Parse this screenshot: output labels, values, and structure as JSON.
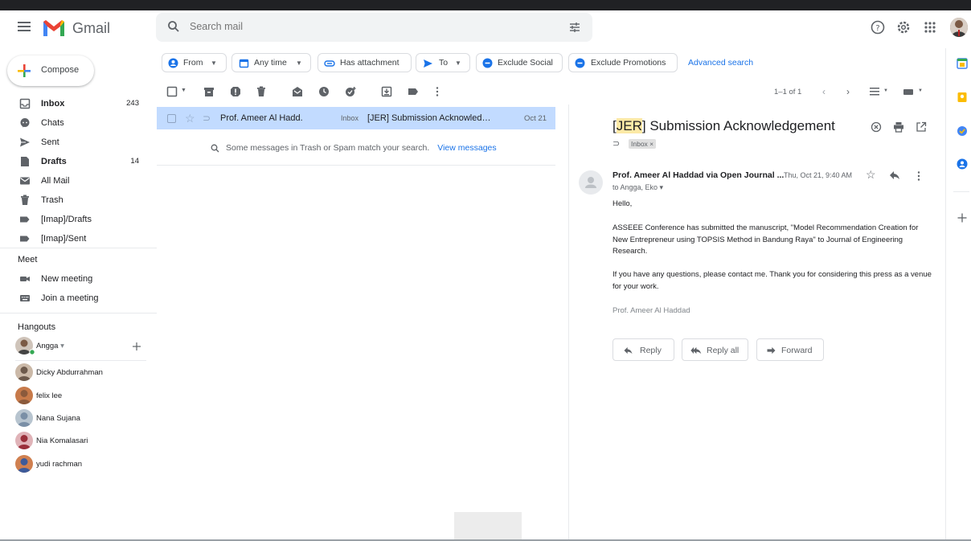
{
  "app": {
    "name": "Gmail"
  },
  "search": {
    "placeholder": "Search mail"
  },
  "compose_label": "Compose",
  "nav": [
    {
      "label": "Inbox",
      "count": "243",
      "bold": true,
      "icon": "inbox-icon"
    },
    {
      "label": "Chats",
      "count": "",
      "bold": false,
      "icon": "chat-icon"
    },
    {
      "label": "Sent",
      "count": "",
      "bold": false,
      "icon": "send-icon"
    },
    {
      "label": "Drafts",
      "count": "14",
      "bold": true,
      "icon": "draft-icon"
    },
    {
      "label": "All Mail",
      "count": "",
      "bold": false,
      "icon": "all-mail-icon"
    },
    {
      "label": "Trash",
      "count": "",
      "bold": false,
      "icon": "trash-icon"
    },
    {
      "label": "[Imap]/Drafts",
      "count": "",
      "bold": false,
      "icon": "label-icon"
    },
    {
      "label": "[Imap]/Sent",
      "count": "",
      "bold": false,
      "icon": "label-icon"
    }
  ],
  "meet": {
    "title": "Meet",
    "items": [
      {
        "label": "New meeting",
        "icon": "video-icon"
      },
      {
        "label": "Join a meeting",
        "icon": "keyboard-icon"
      }
    ]
  },
  "hangouts": {
    "title": "Hangouts",
    "me": "Angga",
    "contacts": [
      "Dicky Abdurrahman",
      "felix lee",
      "Nana Sujana",
      "Nia Komalasari",
      "yudi rachman"
    ]
  },
  "chips": {
    "from": "From",
    "any_time": "Any time",
    "has_attachment": "Has attachment",
    "to": "To",
    "exclude_social": "Exclude Social",
    "exclude_promotions": "Exclude Promotions",
    "advanced_search": "Advanced search"
  },
  "pager": "1–1 of 1",
  "list": {
    "rows": [
      {
        "sender": "Prof. Ameer Al Hadd.",
        "label": "Inbox",
        "subject": "[JER] Submission Acknowledgement",
        "date": "Oct 21"
      }
    ],
    "trash_note": "Some messages in Trash or Spam match your search.",
    "view_messages": "View messages"
  },
  "message": {
    "subject_highlight": "JER",
    "subject_rest": " Submission Acknowledgement",
    "label": "Inbox",
    "from": "Prof. Ameer Al Haddad via Open Journal ...",
    "date": "Thu, Oct 21, 9:40 AM",
    "to": "to Angga, Eko",
    "greeting": "Hello,",
    "para1": "ASSEEE Conference has submitted the manuscript, \"Model Recommendation Creation for New Entrepreneur using TOPSIS Method in Bandung Raya\" to Journal of Engineering Research.",
    "para2": "If you have any questions, please contact me. Thank you for considering this press as a venue for your work.",
    "signature": "Prof. Ameer Al Haddad"
  },
  "actions": {
    "reply": "Reply",
    "reply_all": "Reply all",
    "forward": "Forward"
  },
  "colors": {
    "selected_row": "#c2dbff",
    "accent": "#1a73e8",
    "highlight": "#fce9a6"
  }
}
